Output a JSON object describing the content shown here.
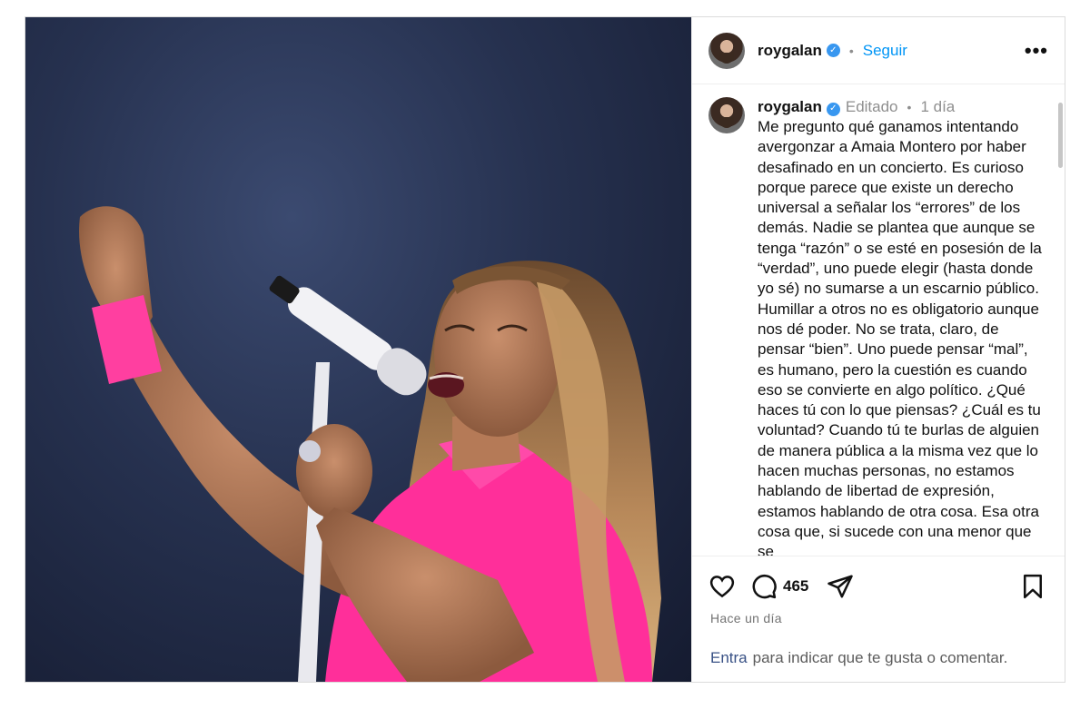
{
  "post": {
    "username": "roygalan",
    "follow_label": "Seguir",
    "separator": "•",
    "more_label": "•••"
  },
  "caption": {
    "username": "roygalan",
    "edited": "Editado",
    "separator": "•",
    "time": "1 día",
    "text": "Me pregunto qué ganamos intentando avergonzar a Amaia Montero por haber desafinado en un concierto. Es curioso porque parece que existe un derecho universal a señalar los “errores” de los demás. Nadie se plantea que aunque se tenga “razón” o se esté en posesión de la “verdad”, uno puede elegir (hasta donde yo sé) no sumarse a un escarnio público. Humillar a otros no es obligatorio aunque nos dé poder.  No se trata, claro, de pensar “bien”. Uno puede pensar “mal”, es humano, pero la cuestión es cuando eso se convierte en algo político. ¿Qué haces tú con lo que piensas? ¿Cuál es tu voluntad? Cuando tú te burlas de alguien de manera pública a la misma vez que lo hacen muchas personas, no estamos hablando de libertad de expresión, estamos hablando de otra cosa. Esa otra cosa que, si sucede con una menor que se"
  },
  "actions": {
    "comment_count": "465",
    "time_ago": "Hace un día"
  },
  "login": {
    "link": "Entra",
    "text": "para indicar que te gusta o comentar."
  },
  "colors": {
    "accent": "#0095f6",
    "verified": "#3897f0",
    "link": "#385185",
    "wristband": "#ff3fa0"
  },
  "icons": {
    "like": "heart-icon",
    "comment": "comment-bubble-icon",
    "share": "paper-plane-icon",
    "save": "bookmark-icon",
    "verified": "verified-badge-icon"
  }
}
